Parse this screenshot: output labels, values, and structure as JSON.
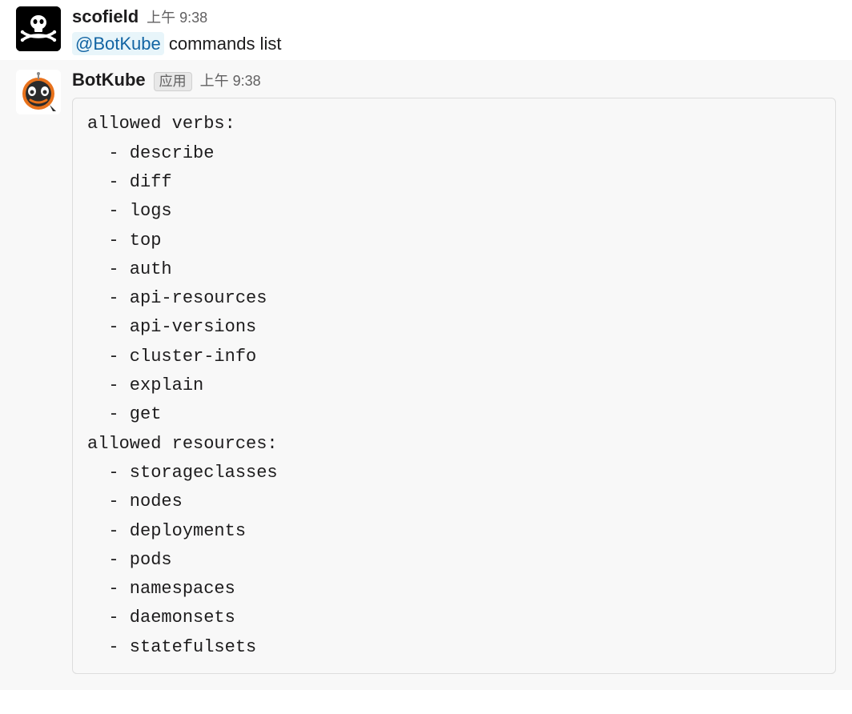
{
  "messages": {
    "user": {
      "username": "scofield",
      "timestamp": "上午 9:38",
      "mention": "@BotKube",
      "text_after": " commands list"
    },
    "bot": {
      "username": "BotKube",
      "badge": "应用",
      "timestamp": "上午 9:38",
      "code": "allowed verbs:\n  - describe\n  - diff\n  - logs\n  - top\n  - auth\n  - api-resources\n  - api-versions\n  - cluster-info\n  - explain\n  - get\nallowed resources:\n  - storageclasses\n  - nodes\n  - deployments\n  - pods\n  - namespaces\n  - daemonsets\n  - statefulsets"
    }
  }
}
